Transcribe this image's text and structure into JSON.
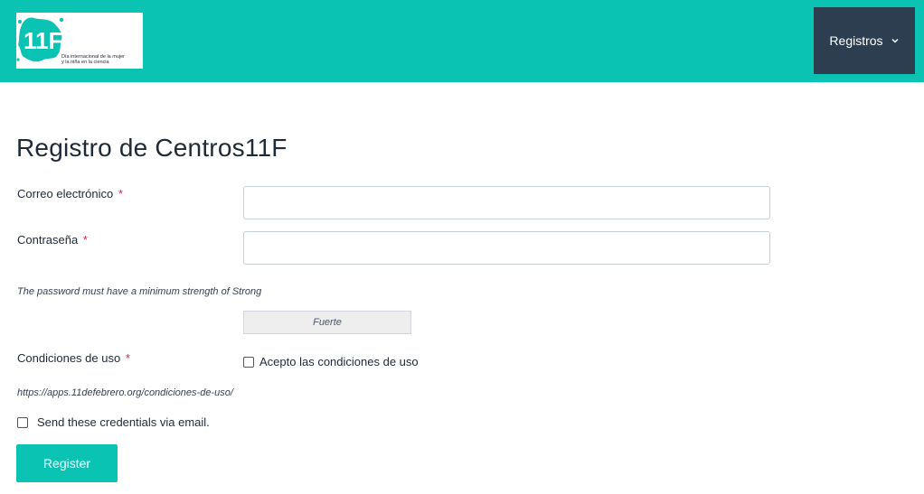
{
  "header": {
    "bg_color": "#0bc3b3",
    "logo": {
      "wordmark": "11Febrero",
      "subtitle": "Día internacional de la mujer\ny la niña en la ciencia"
    },
    "menu_label": "Registros",
    "menu_icon": "chevron-down-icon",
    "menu_bg": "#2c3e50"
  },
  "form": {
    "title": "Registro de Centros11F",
    "email_label": "Correo electrónico",
    "password_label": "Contraseña",
    "required_mark": "*",
    "password_hint": "The password must have a minimum strength of Strong",
    "strength_value": "Fuerte",
    "terms_label": "Condiciones de uso",
    "terms_checkbox_label": "Acepto las condiciones de uso",
    "terms_link": "https://apps.11defebrero.org/condiciones-de-uso/",
    "send_credentials_label": "Send these credentials via email.",
    "register_button": "Register"
  }
}
